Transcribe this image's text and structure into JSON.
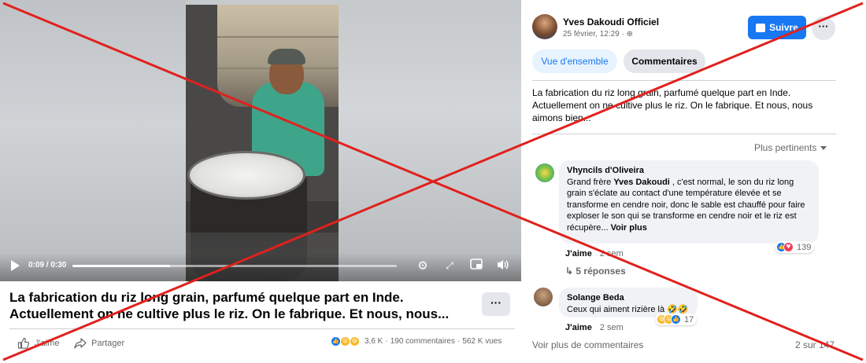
{
  "video": {
    "time": "0:09 / 0:30",
    "progress_fraction": 0.3,
    "icons": [
      "play-icon",
      "gear-icon",
      "expand-icon",
      "pip-icon",
      "volume-icon"
    ]
  },
  "post": {
    "title_line1": "La fabrication du riz long grain, parfumé quelque part en Inde.",
    "title_line2": "Actuellement on ne cultive plus le riz. On le fabrique. Et nous, nous...",
    "more_label": "···",
    "like_label": "J'aime",
    "share_label": "Partager",
    "reactions_count": "3,6 K",
    "comments_count": "190 commentaires",
    "views_count": "562 K vues",
    "separator": "·"
  },
  "panel": {
    "author": "Yves Dakoudi Officiel",
    "date": "25 février, 12:29 · ",
    "date_icon": "globe-icon",
    "follow_label": "Suivre",
    "more_label": "···",
    "tabs": [
      {
        "label": "Vue d'ensemble",
        "active": true
      },
      {
        "label": "Commentaires",
        "active": false
      }
    ],
    "description": "La fabrication du riz long grain, parfumé quelque part en Inde. Actuellement on ne cultive plus le riz. On le fabrique. Et nous, nous aimons bien...",
    "sort_label": "Plus pertinents"
  },
  "comments": [
    {
      "name": "Vhyncils d'Oliveira",
      "text_pre": "Grand frère ",
      "mention": "Yves Dakoudi",
      "text_post": " , c'est normal, le son du riz long grain s'éclate au contact d'une température élevée et se transforme en cendre noir, donc le sable est chauffé pour faire exploser le son qui se transforme en cendre noir et le riz est récupère... ",
      "see_more": "Voir plus",
      "like_label": "J'aime",
      "age": "2 sem",
      "reaction_count": "139",
      "replies": "↳ 5 réponses"
    },
    {
      "name": "Solange Beda",
      "text": "Ceux qui aiment rizière là 🤣🤣",
      "like_label": "J'aime",
      "age": "2 sem",
      "reaction_count": "17"
    }
  ],
  "footer": {
    "more_comments": "Voir plus de commentaires",
    "page_count": "2 sur 147"
  },
  "colors": {
    "accent": "#1877f2",
    "cross": "#e0211d",
    "secondary_text": "#65676b"
  }
}
